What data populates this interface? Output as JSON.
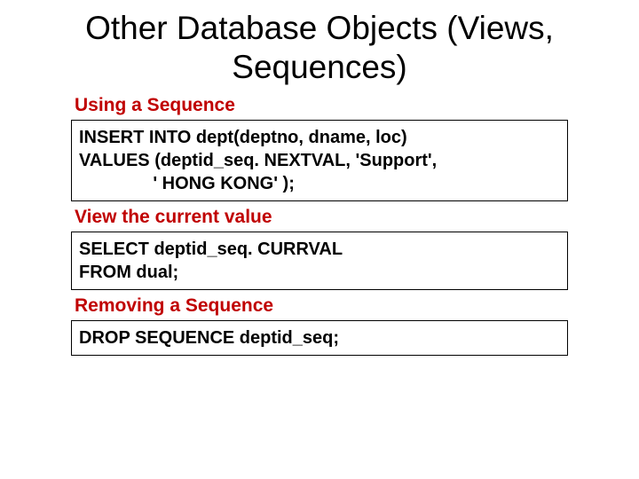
{
  "title": "Other Database Objects (Views, Sequences)",
  "sections": [
    {
      "label": "Using a Sequence",
      "code": "INSERT INTO dept(deptno, dname, loc)\nVALUES (deptid_seq. NEXTVAL, 'Support',\n               ' HONG KONG' );"
    },
    {
      "label": "View the current value",
      "code": "SELECT deptid_seq. CURRVAL\nFROM dual;"
    },
    {
      "label": "Removing a Sequence",
      "code": "DROP SEQUENCE deptid_seq;"
    }
  ]
}
